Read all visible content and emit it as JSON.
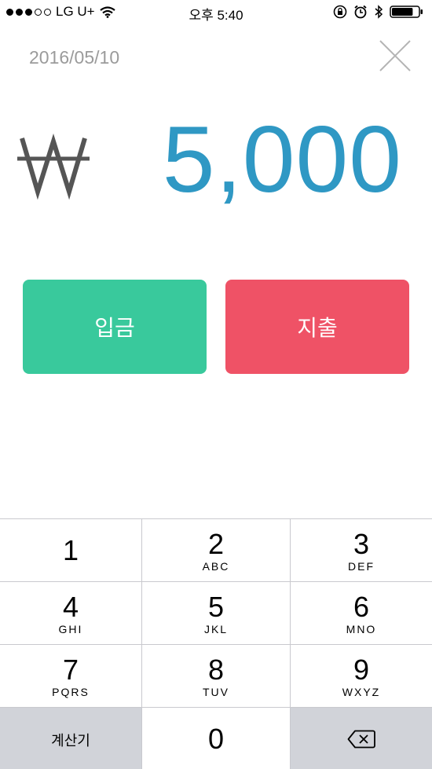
{
  "status_bar": {
    "carrier": "LG U+",
    "signal_bars_filled": 3,
    "signal_bars_total": 5,
    "time": "오후 5:40",
    "icons": [
      "wifi-icon",
      "rotation-lock-icon",
      "alarm-icon",
      "bluetooth-icon",
      "battery-icon"
    ],
    "battery_level": 0.8
  },
  "header": {
    "date": "2016/05/10",
    "close_icon": "close-icon"
  },
  "amount": {
    "currency_symbol": "₩",
    "value": "5,000",
    "color": "#2f98c4"
  },
  "actions": {
    "deposit_label": "입금",
    "deposit_color": "#39c99c",
    "withdraw_label": "지출",
    "withdraw_color": "#ef5266"
  },
  "keypad": {
    "keys": [
      {
        "num": "1",
        "letters": ""
      },
      {
        "num": "2",
        "letters": "ABC"
      },
      {
        "num": "3",
        "letters": "DEF"
      },
      {
        "num": "4",
        "letters": "GHI"
      },
      {
        "num": "5",
        "letters": "JKL"
      },
      {
        "num": "6",
        "letters": "MNO"
      },
      {
        "num": "7",
        "letters": "PQRS"
      },
      {
        "num": "8",
        "letters": "TUV"
      },
      {
        "num": "9",
        "letters": "WXYZ"
      }
    ],
    "calculator_label": "계산기",
    "zero": "0",
    "backspace_icon": "backspace-icon"
  }
}
